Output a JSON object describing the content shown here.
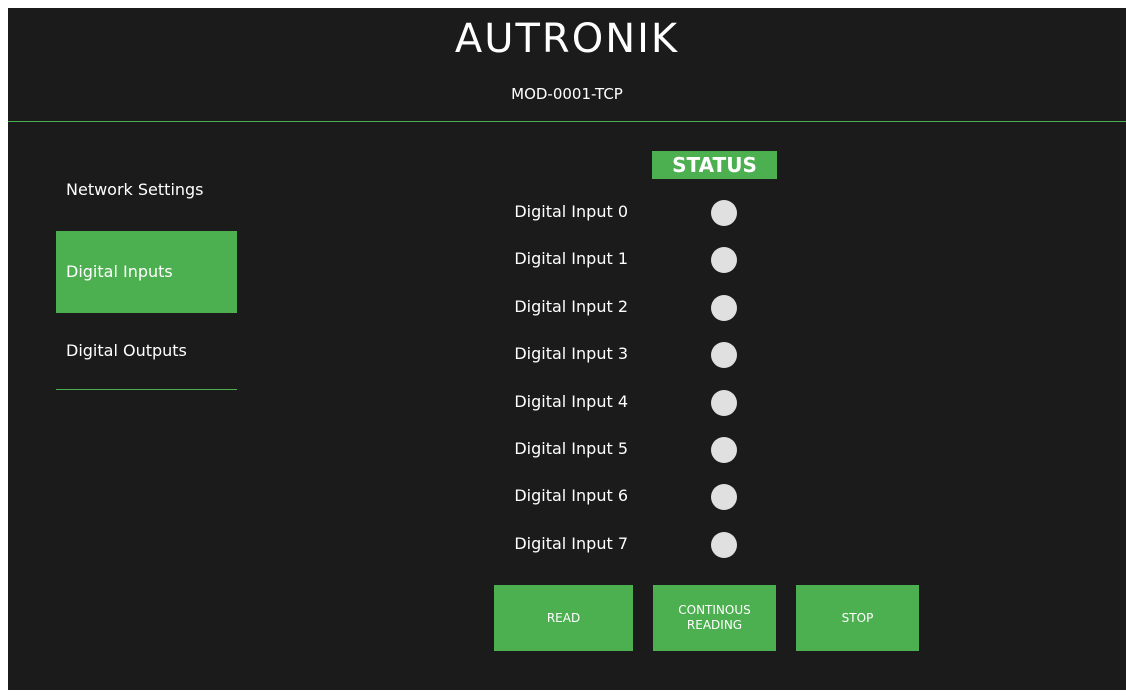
{
  "header": {
    "brand": "AUTRONIK",
    "model": "MOD-0001-TCP"
  },
  "sidebar": {
    "items": [
      {
        "label": "Network Settings",
        "active": false
      },
      {
        "label": "Digital Inputs",
        "active": true
      },
      {
        "label": "Digital Outputs",
        "active": false
      }
    ]
  },
  "status": {
    "heading": "STATUS",
    "inputs": [
      {
        "label": "Digital Input 0",
        "state": "off"
      },
      {
        "label": "Digital Input 1",
        "state": "off"
      },
      {
        "label": "Digital Input 2",
        "state": "off"
      },
      {
        "label": "Digital Input 3",
        "state": "off"
      },
      {
        "label": "Digital Input 4",
        "state": "off"
      },
      {
        "label": "Digital Input 5",
        "state": "off"
      },
      {
        "label": "Digital Input 6",
        "state": "off"
      },
      {
        "label": "Digital Input 7",
        "state": "off"
      }
    ]
  },
  "buttons": {
    "read": "READ",
    "continuous_line1": "CONTINOUS",
    "continuous_line2": "READING",
    "stop": "STOP"
  },
  "colors": {
    "accent": "#4caf50",
    "background": "#1b1b1b",
    "led_off": "#e0e0e0"
  }
}
